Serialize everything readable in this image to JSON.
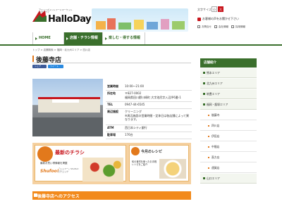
{
  "header": {
    "logo_tagline": "アミューズメントフードマーケット",
    "logo_tagline_2": "ハローデイ",
    "logo_text": "HalloDay",
    "font_size_label": "文字サイズ",
    "font_small": "小",
    "font_large": "大",
    "notice": "お客様の声をお聞かせ下さい",
    "sublinks": [
      "お問合せ",
      "会社情報",
      "採用情報"
    ]
  },
  "nav": {
    "home": "HOME",
    "stores": "店舗・チラシ情報",
    "enjoy": "楽しむ・得する情報"
  },
  "breadcrumb": "トップ > 店舗検索 > 福岡・北九州エリア > 四川店",
  "page_title": "後藤寺店",
  "share": {
    "facebook": "シェア",
    "twitter": "ツイート"
  },
  "store_info": [
    {
      "key": "営業時間",
      "value": "10:00～21:00"
    },
    {
      "key": "所在地",
      "value": "〒827-0002"
    },
    {
      "key": "",
      "value": "福岡県田川郡川崎町 大字池尻字入辺坪6番-1"
    },
    {
      "key": "TEL",
      "value": "0947-44-6545"
    },
    {
      "key": "周辺施設",
      "value": "クリーニング"
    },
    {
      "key": "",
      "value": "※周辺施設の営業時間・定休日は各店舗によって異なります。"
    },
    {
      "key": "ATM",
      "value": "西日本シティ銀行"
    },
    {
      "key": "駐車場",
      "value": "176台"
    }
  ],
  "promo": {
    "flyer_title": "最新のチラシ",
    "flyer_sub": "最新お買い得情報を掲載",
    "shufoo": "Shufoo!",
    "shufoo_note": "『シュフー』Shufoo! でチェック",
    "recipe_title": "今月のレシピ",
    "recipe_text": "旬の食材を使ったお手軽レシピをご紹介"
  },
  "access_title": "後藤寺店へのアクセス",
  "sidebar": {
    "heading": "店舗紹介",
    "areas": [
      "熊本エリア",
      "北九州エリア",
      "筑豊エリア",
      "福岡・飯塚エリア"
    ],
    "stores": [
      "後藤寺",
      "四川店",
      "伊田店",
      "中間店",
      "直方店",
      "遠賀店"
    ],
    "last_area": "山口エリア"
  },
  "colors": {
    "brand_green": "#3a6f2c",
    "brand_red": "#c8161d",
    "accent_orange": "#f28a1c"
  }
}
